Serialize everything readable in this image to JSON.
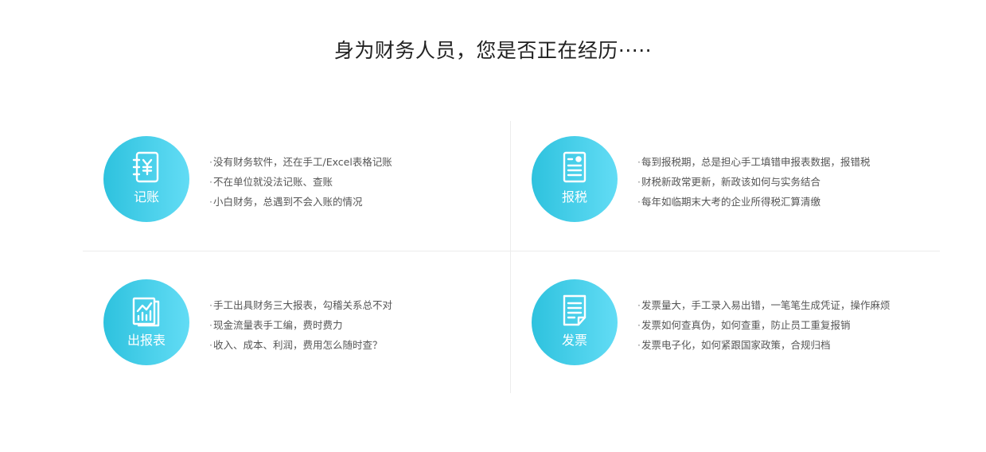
{
  "header": {
    "title": "身为财务人员，您是否正在经历·····"
  },
  "cards": [
    {
      "label": "记账",
      "icon": "ledger-yen-icon",
      "lines": [
        "没有财务软件，还在手工/Excel表格记账",
        "不在单位就没法记账、查账",
        "小白财务，总遇到不会入账的情况"
      ]
    },
    {
      "label": "报税",
      "icon": "tax-document-icon",
      "lines": [
        "每到报税期，总是担心手工填错申报表数据，报错税",
        "财税新政常更新，新政该如何与实务结合",
        "每年如临期末大考的企业所得税汇算清缴"
      ]
    },
    {
      "label": "出报表",
      "icon": "report-chart-icon",
      "lines": [
        "手工出具财务三大报表，勾稽关系总不对",
        "现金流量表手工编，费时费力",
        "收入、成本、利润，费用怎么随时查？"
      ]
    },
    {
      "label": "发票",
      "icon": "invoice-icon",
      "lines": [
        "发票量大，手工录入易出错，一笔笔生成凭证，操作麻烦",
        "发票如何查真伪，如何查重，防止员工重复报销",
        "发票电子化，如何紧跟国家政策，合规归档"
      ]
    }
  ],
  "colors": {
    "circle_gradient_start": "#2ec2de",
    "circle_gradient_end": "#62dcf5",
    "title": "#222222",
    "text": "#555555",
    "divider": "#ececec"
  }
}
